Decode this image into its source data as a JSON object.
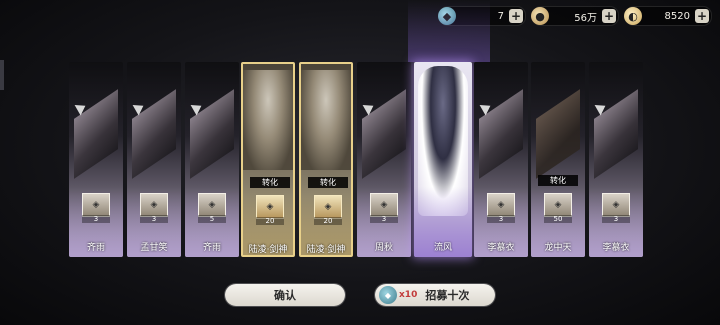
{
  "resources": [
    {
      "icon": "token-icon",
      "value": "7"
    },
    {
      "icon": "coin-icon",
      "value": "56万"
    },
    {
      "icon": "jade-icon",
      "value": "8520"
    }
  ],
  "cards": [
    {
      "name": "齐雨",
      "count": "3",
      "tag": "",
      "style": "normal"
    },
    {
      "name": "孟甘笑",
      "count": "3",
      "tag": "",
      "style": "normal"
    },
    {
      "name": "齐雨",
      "count": "5",
      "tag": "",
      "style": "normal"
    },
    {
      "name": "陆凌·剑神",
      "count": "20",
      "tag": "转化",
      "style": "gold"
    },
    {
      "name": "陆凌·剑神",
      "count": "20",
      "tag": "转化",
      "style": "gold"
    },
    {
      "name": "周秋",
      "count": "3",
      "tag": "",
      "style": "normal"
    },
    {
      "name": "流风",
      "count": "",
      "tag": "",
      "style": "featured"
    },
    {
      "name": "李慕衣",
      "count": "3",
      "tag": "",
      "style": "normal"
    },
    {
      "name": "龙中天",
      "count": "50",
      "tag": "转化",
      "style": "normal"
    },
    {
      "name": "李慕衣",
      "count": "3",
      "tag": "",
      "style": "normal"
    }
  ],
  "buttons": {
    "confirm": "确认",
    "recruit": "招募十次",
    "recruit_multiplier": "x10"
  },
  "colors": {
    "gold_border": "#e8d08a",
    "featured_glow": "#be96ff",
    "button_bg": "#f5f3ee",
    "multiplier": "#c23b3b"
  }
}
